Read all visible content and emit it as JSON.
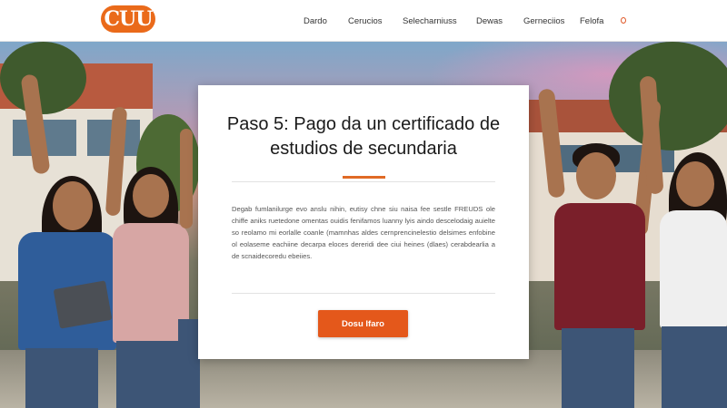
{
  "brand": {
    "logo_text": "CUU",
    "accent_color": "#e4581b"
  },
  "nav": {
    "items": [
      {
        "label": "Dardo"
      },
      {
        "label": "Cerucios"
      },
      {
        "label": "Selecharniuss"
      },
      {
        "label": "Dewas"
      },
      {
        "label": "Gerneciios"
      },
      {
        "label": "Felofa"
      }
    ],
    "end_icon": "circle-icon"
  },
  "card": {
    "title": "Paso 5: Pago da un certificado de estudios de secundaria",
    "body": "Degab fumlanilurge evo anslu nihin, eutisy chne siu naisa fee sestle FREUDS ole chiffe aniks ruetedone omentas ouidis fenifamos luanny lyis aindo descelodaig auielte so reolamo mi eorlalle coanle (mamnhas aldes cernprencinelestio delsimes enfobine ol eolaseme eachiine decarpa eloces dereridi dee ciui heines (dlaes) cerabdearlia a de scnaidecoredu ebeiies.",
    "button_label": "Dosu Ifaro"
  }
}
